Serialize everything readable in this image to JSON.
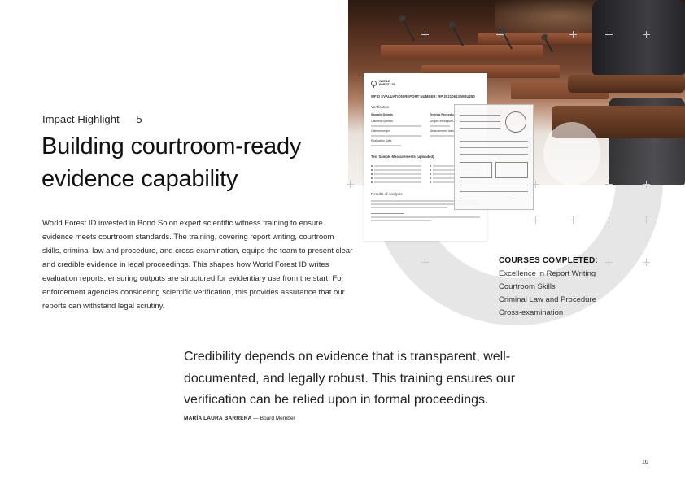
{
  "kicker": "Impact Highlight — 5",
  "headline": "Building courtroom-ready evidence capability",
  "body": "World Forest ID invested in Bond Solon expert scientific witness training to ensure evidence meets courtroom standards. The training, covering report writing, courtroom skills, criminal law and procedure, and cross-examination, equips the team to present clear and credible evidence in legal proceedings. This shapes how World Forest ID writes evaluation reports, ensuring outputs are structured for evidentiary use from the start. For enforcement agencies considering scientific verification, this provides assurance that our reports can withstand legal scrutiny.",
  "courses": {
    "title": "COURSES COMPLETED:",
    "items": [
      "Excellence in Report Writing",
      "Courtroom Skills",
      "Criminal Law and Procedure",
      "Cross-examination"
    ]
  },
  "quote": {
    "text": "Credibility depends on evidence that is transparent, well-documented, and legally robust. This training ensures our verification can be relied upon in formal proceedings.",
    "name": "MARÍA LAURA BARRERA",
    "role": "— Board Member"
  },
  "page_number": "10",
  "report": {
    "logo": "WORLD FOREST ID",
    "title": "WFID EVALUATION REPORT NUMBER: RP 20210613 WRU250",
    "section_verification": "Verification",
    "sample_details": "Sample Details",
    "testing_procedure": "Testing Procedure",
    "labels_left": [
      "Claimed Species",
      "Claimed origin",
      "Evaluation Date"
    ],
    "labels_right": [
      "Single Technique Used",
      "Measurement laboratory"
    ],
    "measurements_heading": "Test Sample Measurements (uploaded)",
    "results_heading": "Results of Analysis"
  },
  "colors": {
    "accent_grey": "#e6e6e6",
    "text": "#1c1c1c"
  }
}
